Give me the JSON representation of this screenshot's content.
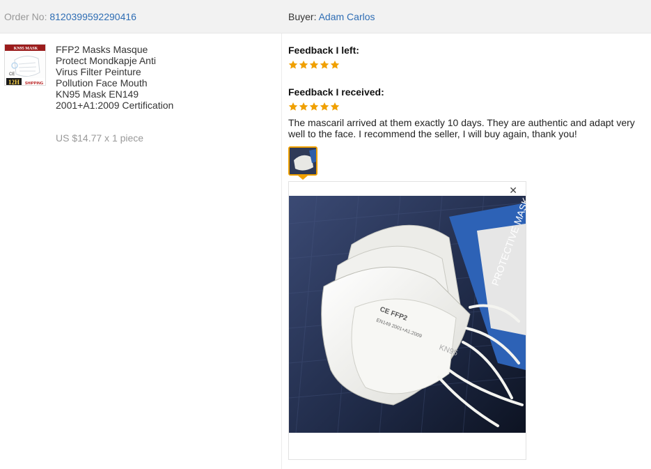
{
  "header": {
    "order_label": "Order No:",
    "order_number": "8120399592290416",
    "buyer_label": "Buyer:",
    "buyer_name": "Adam Carlos"
  },
  "product": {
    "title": "FFP2 Masks Masque Protect Mondkapje Anti Virus Filter Peinture Pollution Face Mouth KN95 Mask EN149 2001+A1:2009 Certification",
    "price": "US $14.77 x 1 piece",
    "thumb_text_top": "KN95 MASK",
    "thumb_text_badge": "12H",
    "thumb_text_shipping": "SHIPPING",
    "thumb_text_ce": "CE"
  },
  "feedback": {
    "left_heading": "Feedback I left:",
    "left_rating": 5,
    "received_heading": "Feedback I received:",
    "received_rating": 5,
    "comment": "The mascaril arrived at them exactly 10 days. They are authentic and adapt very well to the face. I recommend the seller, I will buy again, thank you!",
    "close_glyph": "✕"
  },
  "photo": {
    "mask_text_1": "CE FFP2",
    "mask_text_2": "EN149 2001+A1:2009",
    "mask_text_3": "KN95",
    "package_text": "PROTECTIVE MASK"
  },
  "colors": {
    "star": "#f0a000",
    "link": "#2e6db4",
    "header_bg": "#f2f2f2"
  }
}
